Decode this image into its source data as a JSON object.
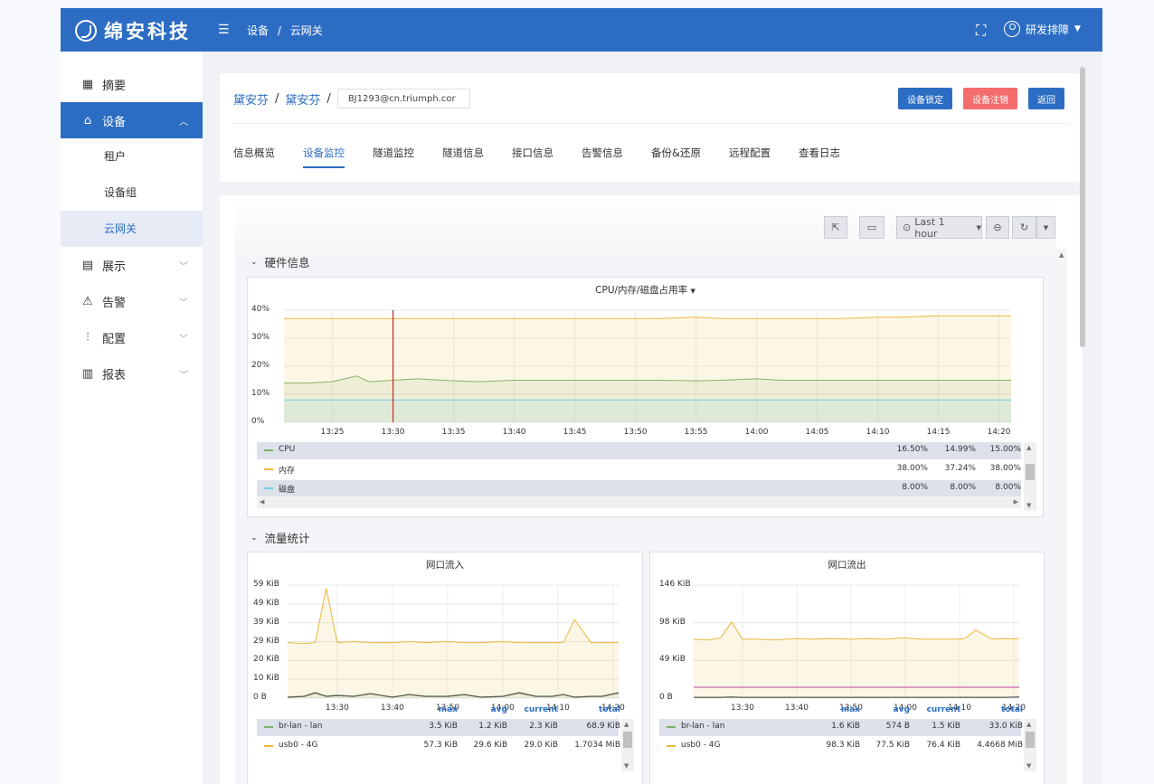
{
  "brand": "绵安科技",
  "topbar": {
    "crumbs": [
      "设备",
      "云网关"
    ],
    "user": "研发排障"
  },
  "sidebar": {
    "items": [
      {
        "label": "摘要",
        "icon": "grid-icon"
      },
      {
        "label": "设备",
        "icon": "home-icon"
      },
      {
        "label": "展示",
        "icon": "table-icon"
      },
      {
        "label": "告警",
        "icon": "warning-icon"
      },
      {
        "label": "配置",
        "icon": "sliders-icon"
      },
      {
        "label": "报表",
        "icon": "barchart-icon"
      }
    ],
    "sub": [
      "租户",
      "设备组",
      "云网关"
    ]
  },
  "device": {
    "crumbs": [
      "黛安芬",
      "黛安芬"
    ],
    "account_value": "BJ1293@cn.triumph.cor",
    "buttons": {
      "lock": "设备锁定",
      "cancel": "设备注销",
      "back": "返回"
    },
    "tabs": [
      "信息概览",
      "设备监控",
      "隧道监控",
      "隧道信息",
      "接口信息",
      "告警信息",
      "备份&还原",
      "远程配置",
      "查看日志"
    ]
  },
  "toolbar": {
    "time_range": "Last 1 hour"
  },
  "rows": [
    "硬件信息",
    "流量统计"
  ],
  "colors": {
    "primary": "#2c6dc3",
    "danger": "#f56c6c",
    "green": "#7eb26d",
    "yellow": "#eab839",
    "cyan": "#6ed0e0",
    "purple": "#ba43a9",
    "dark": "#5a5a5a"
  },
  "chart_data": [
    {
      "type": "line",
      "title": "CPU/内存/磁盘占用率",
      "x": [
        "13:21",
        "13:23",
        "13:25",
        "13:27",
        "13:28",
        "13:30",
        "13:32",
        "13:35",
        "13:37",
        "13:40",
        "13:42",
        "13:45",
        "13:47",
        "13:50",
        "13:52",
        "13:55",
        "13:57",
        "14:00",
        "14:02",
        "14:05",
        "14:07",
        "14:10",
        "14:12",
        "14:15",
        "14:17",
        "14:20",
        "14:21"
      ],
      "x_ticks": [
        "13:25",
        "13:30",
        "13:35",
        "13:40",
        "13:45",
        "13:50",
        "13:55",
        "14:00",
        "14:05",
        "14:10",
        "14:15",
        "14:20"
      ],
      "y_ticks": [
        "40%",
        "30%",
        "20%",
        "10%",
        "0%"
      ],
      "ylim": [
        0,
        40
      ],
      "legend_columns": [],
      "series": [
        {
          "name": "CPU",
          "color": "#7eb26d",
          "values": [
            14,
            14,
            14.5,
            16.5,
            14.5,
            15,
            15.5,
            14.8,
            14.5,
            15,
            15,
            15,
            15,
            15,
            15,
            14.8,
            15,
            15.5,
            15,
            15,
            15,
            15,
            15,
            15,
            15,
            15,
            15
          ],
          "stats": [
            "16.50%",
            "14.99%",
            "15.00%"
          ]
        },
        {
          "name": "内存",
          "color": "#eab839",
          "values": [
            37,
            37,
            37,
            37,
            37,
            37,
            37,
            37,
            37,
            37,
            37,
            37,
            37,
            37,
            37,
            37.5,
            37,
            37,
            37,
            37,
            37,
            37.5,
            37.5,
            38,
            38,
            38,
            38
          ],
          "stats": [
            "38.00%",
            "37.24%",
            "38.00%"
          ]
        },
        {
          "name": "磁盘",
          "color": "#6ed0e0",
          "values": [
            8,
            8,
            8,
            8,
            8,
            8,
            8,
            8,
            8,
            8,
            8,
            8,
            8,
            8,
            8,
            8,
            8,
            8,
            8,
            8,
            8,
            8,
            8,
            8,
            8,
            8,
            8
          ],
          "stats": [
            "8.00%",
            "8.00%",
            "8.00%"
          ]
        }
      ]
    },
    {
      "type": "line",
      "title": "网口流入",
      "x": [
        "13:21",
        "13:24",
        "13:26",
        "13:28",
        "13:30",
        "13:33",
        "13:36",
        "13:40",
        "13:43",
        "13:46",
        "13:50",
        "13:53",
        "13:56",
        "14:00",
        "14:03",
        "14:06",
        "14:09",
        "14:11",
        "14:13",
        "14:16",
        "14:18",
        "14:21"
      ],
      "x_ticks": [
        "13:30",
        "13:40",
        "13:50",
        "14:00",
        "14:10",
        "14:20"
      ],
      "y_ticks": [
        "59 KiB",
        "49 KiB",
        "39 KiB",
        "29 KiB",
        "20 KiB",
        "10 KiB",
        "0 B"
      ],
      "ylim": [
        0,
        59
      ],
      "legend_columns": [
        "max",
        "avg",
        "current",
        "total"
      ],
      "series": [
        {
          "name": "br-lan - lan",
          "color": "#7eb26d",
          "values": [
            0.5,
            1,
            3,
            1,
            1.5,
            1,
            2.5,
            0.5,
            2,
            1,
            1,
            2,
            0.5,
            1,
            3,
            1,
            1,
            2,
            0.5,
            1,
            1,
            3
          ],
          "stats": [
            "3.5 KiB",
            "1.2 KiB",
            "2.3 KiB",
            "68.9 KiB"
          ]
        },
        {
          "name": "usb0 - 4G",
          "color": "#eab839",
          "values": [
            29,
            28.5,
            29,
            57.3,
            29,
            29.5,
            29,
            29,
            29.5,
            29,
            29.5,
            29,
            29,
            29.5,
            29,
            29,
            29,
            29,
            41,
            29,
            29,
            29
          ],
          "stats": [
            "57.3 KiB",
            "29.6 KiB",
            "29.0 KiB",
            "1.7034 MiB"
          ]
        }
      ]
    },
    {
      "type": "line",
      "title": "网口流出",
      "x": [
        "13:21",
        "13:24",
        "13:26",
        "13:28",
        "13:30",
        "13:33",
        "13:36",
        "13:40",
        "13:43",
        "13:46",
        "13:50",
        "13:53",
        "13:56",
        "14:00",
        "14:03",
        "14:06",
        "14:09",
        "14:11",
        "14:13",
        "14:16",
        "14:18",
        "14:21"
      ],
      "x_ticks": [
        "13:30",
        "13:40",
        "13:50",
        "14:00",
        "14:10",
        "14:20"
      ],
      "y_ticks": [
        "146 KiB",
        "98 KiB",
        "49 KiB",
        "0 B"
      ],
      "ylim": [
        0,
        146
      ],
      "legend_columns": [
        "max",
        "avg",
        "current",
        "total"
      ],
      "series": [
        {
          "name": "br-lan - lan",
          "color": "#7eb26d",
          "values": [
            1,
            1,
            1,
            1.6,
            1,
            1,
            1,
            1,
            1,
            1,
            1,
            1,
            1,
            1,
            1,
            1,
            1,
            1,
            1,
            1,
            1,
            1.5
          ],
          "stats": [
            "1.6 KiB",
            "574 B",
            "1.5 KiB",
            "33.0 KiB"
          ]
        },
        {
          "name": "usb0 - 4G",
          "color": "#eab839",
          "values": [
            76,
            75,
            78,
            98.3,
            76,
            76,
            75,
            77,
            76,
            77,
            76,
            77,
            76,
            78,
            76,
            76,
            76,
            77,
            88,
            76,
            77,
            76.4
          ],
          "stats": [
            "98.3 KiB",
            "77.5 KiB",
            "76.4 KiB",
            "4.4668 MiB"
          ]
        }
      ]
    }
  ]
}
